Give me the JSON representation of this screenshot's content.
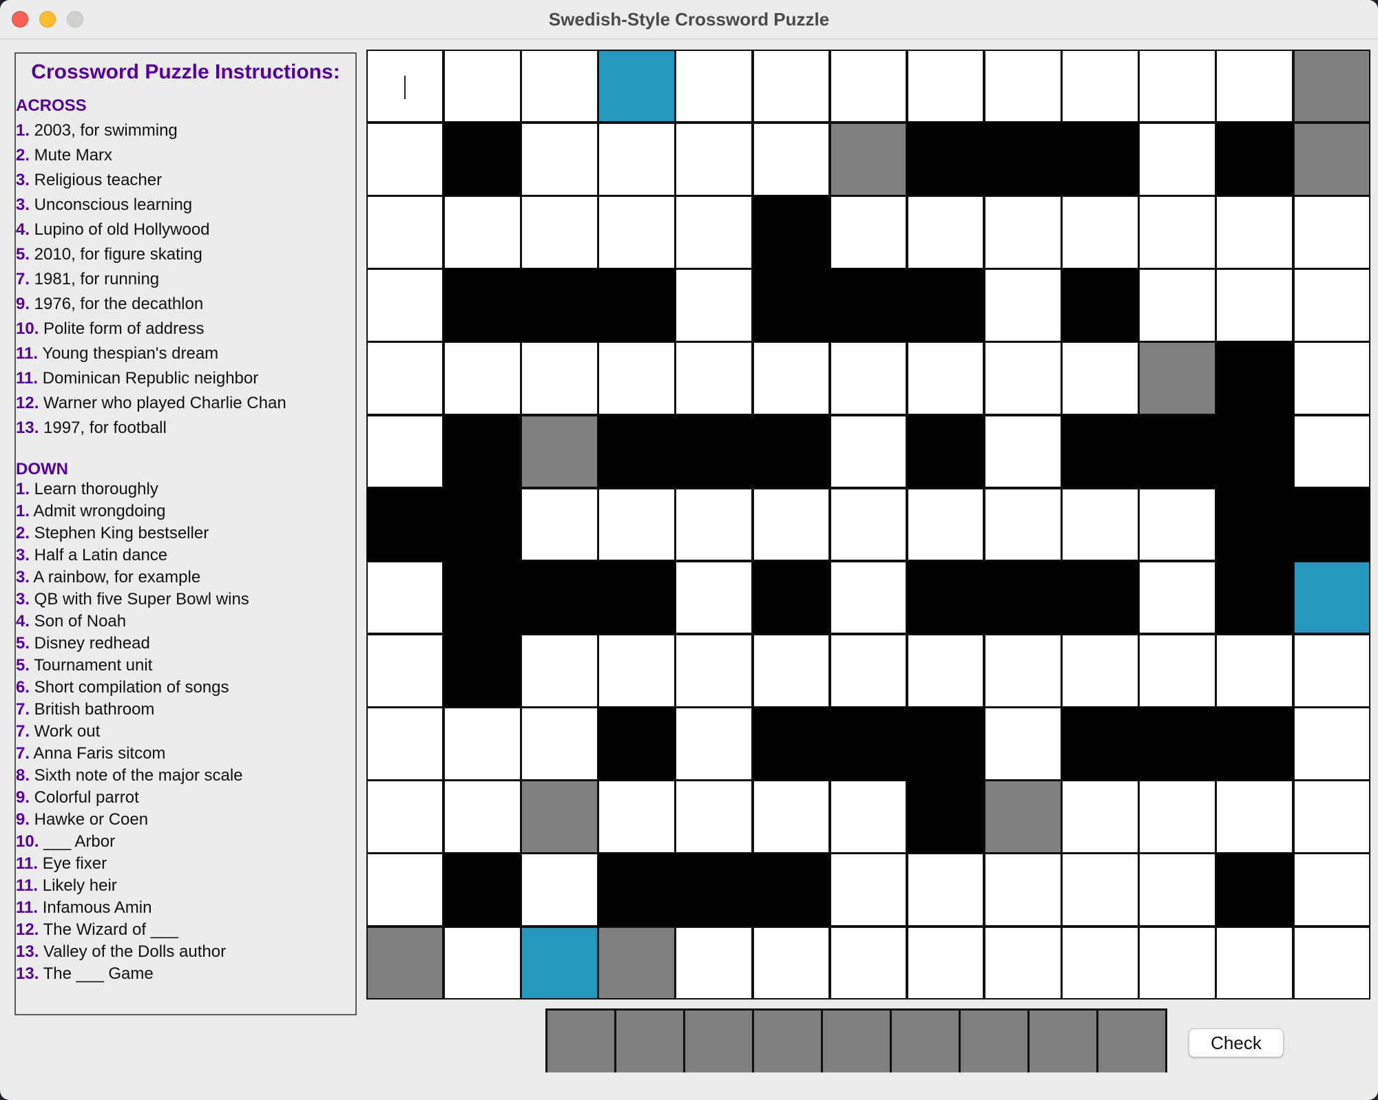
{
  "window": {
    "title": "Swedish-Style Crossword Puzzle"
  },
  "panel": {
    "heading": "Crossword Puzzle Instructions:",
    "across_label": "ACROSS",
    "down_label": "DOWN",
    "across": [
      {
        "num": "1.",
        "text": "2003, for swimming"
      },
      {
        "num": "2.",
        "text": "Mute Marx"
      },
      {
        "num": "3.",
        "text": "Religious teacher"
      },
      {
        "num": "3.",
        "text": "Unconscious learning"
      },
      {
        "num": "4.",
        "text": "Lupino of old Hollywood"
      },
      {
        "num": "5.",
        "text": "2010, for figure skating"
      },
      {
        "num": "7.",
        "text": "1981, for running"
      },
      {
        "num": "9.",
        "text": "1976, for the decathlon"
      },
      {
        "num": "10.",
        "text": "Polite form of address"
      },
      {
        "num": "11.",
        "text": "Young thespian's dream"
      },
      {
        "num": "11.",
        "text": "Dominican Republic neighbor"
      },
      {
        "num": "12.",
        "text": "Warner who played Charlie Chan"
      },
      {
        "num": "13.",
        "text": "1997, for football"
      }
    ],
    "down": [
      {
        "num": "1.",
        "text": "Learn thoroughly"
      },
      {
        "num": "1.",
        "text": "Admit wrongdoing"
      },
      {
        "num": "2.",
        "text": "Stephen King bestseller"
      },
      {
        "num": "3.",
        "text": "Half a Latin dance"
      },
      {
        "num": "3.",
        "text": "A rainbow, for example"
      },
      {
        "num": "3.",
        "text": "QB with five Super Bowl wins"
      },
      {
        "num": "4.",
        "text": "Son of Noah"
      },
      {
        "num": "5.",
        "text": "Disney redhead"
      },
      {
        "num": "5.",
        "text": "Tournament unit"
      },
      {
        "num": "6.",
        "text": "Short compilation of songs"
      },
      {
        "num": "7.",
        "text": "British bathroom"
      },
      {
        "num": "7.",
        "text": "Work out"
      },
      {
        "num": "7.",
        "text": "Anna Faris sitcom"
      },
      {
        "num": "8.",
        "text": "Sixth note of the major scale"
      },
      {
        "num": "9.",
        "text": "Colorful parrot"
      },
      {
        "num": "9.",
        "text": "Hawke or Coen"
      },
      {
        "num": "10.",
        "text": "___ Arbor"
      },
      {
        "num": "11.",
        "text": "Eye fixer"
      },
      {
        "num": "11.",
        "text": "Likely heir"
      },
      {
        "num": "11.",
        "text": "Infamous Amin"
      },
      {
        "num": "12.",
        "text": "The Wizard of ___"
      },
      {
        "num": "13.",
        "text": "Valley of the Dolls author"
      },
      {
        "num": "13.",
        "text": "The ___ Game"
      }
    ]
  },
  "grid": {
    "rows": 13,
    "cols": 13,
    "legend": {
      "W": "white",
      "B": "black",
      "G": "gray",
      "L": "blue"
    },
    "colors": {
      "W": "#ffffff",
      "B": "#000000",
      "G": "#808080",
      "L": "#2596be"
    },
    "layout": [
      "WWWLWWWWWWWWG",
      "WBWWWWGBBBWBG",
      "WWWWWBWWWWWWW",
      "WBBBWBBBWBWWW",
      "WWWWWWWWWWGBW",
      "WBGBBBWBWBBBW",
      "BBWWWWWWWWWBB",
      "WBBBWBWBBBWBL",
      "WBWWWWWWWWWWW",
      "WWWBWBBBWBBBW",
      "WWGWWWWBGWWWW",
      "WBWBBBWWWWWBW",
      "GWLGWWWWWWWWW"
    ],
    "active_cell": {
      "row": 0,
      "col": 0
    }
  },
  "answer_slots": {
    "count": 9,
    "color": "#808080"
  },
  "check_button": {
    "label": "Check"
  }
}
